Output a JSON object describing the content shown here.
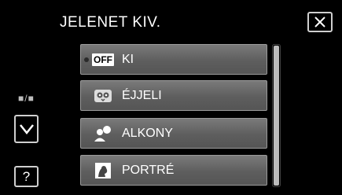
{
  "header": {
    "title": "JELENET KIV.",
    "close_icon": "close-x-icon"
  },
  "side": {
    "page_indicator": "■/■",
    "next_icon": "chevron-down-icon",
    "help_label": "?"
  },
  "menu": {
    "items": [
      {
        "label": "KI",
        "icon": "off-badge-icon",
        "badge": "OFF"
      },
      {
        "label": "ÉJJELI",
        "icon": "night-owl-icon"
      },
      {
        "label": "ALKONY",
        "icon": "sunset-icon"
      },
      {
        "label": "PORTRÉ",
        "icon": "portrait-icon"
      }
    ]
  },
  "colors": {
    "background": "#000000",
    "item_fill": "#666666",
    "border": "#cfcfcf"
  }
}
